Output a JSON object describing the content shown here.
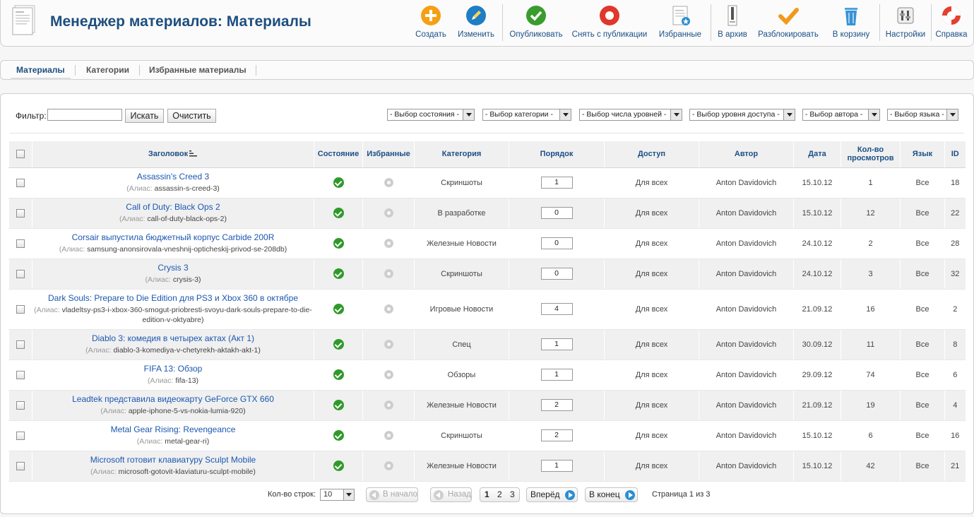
{
  "header": {
    "title": "Менеджер материалов: Материалы"
  },
  "toolbar": {
    "create": "Создать",
    "edit": "Изменить",
    "publish": "Опубликовать",
    "unpublish": "Снять с публикации",
    "featured": "Избранные",
    "archive": "В архив",
    "unlock": "Разблокировать",
    "trash": "В корзину",
    "settings": "Настройки",
    "help": "Справка"
  },
  "tabs": {
    "articles": "Материалы",
    "categories": "Категории",
    "featured": "Избранные материалы"
  },
  "filter": {
    "label": "Фильтр:",
    "value": "",
    "search_button": "Искать",
    "clear_button": "Очистить",
    "state_select": "- Выбор состояния -",
    "category_select": "- Выбор категории -",
    "levels_select": "- Выбор числа уровней -",
    "access_select": "- Выбор уровня доступа -",
    "author_select": "- Выбор автора -",
    "language_select": "- Выбор языка -"
  },
  "table": {
    "headers": {
      "title": "Заголовок",
      "state": "Состояние",
      "featured": "Избранные",
      "category": "Категория",
      "order": "Порядок",
      "access": "Доступ",
      "author": "Автор",
      "date": "Дата",
      "hits": "Кол-во просмотров",
      "language": "Язык",
      "id": "ID"
    },
    "alias_label": "(Алиас:",
    "rows": [
      {
        "title": "Assassin's Creed 3",
        "alias": "assassin-s-creed-3)",
        "category": "Скриншоты",
        "order": "1",
        "access": "Для всех",
        "author": "Anton Davidovich",
        "date": "15.10.12",
        "hits": "1",
        "language": "Все",
        "id": "18"
      },
      {
        "title": "Call of Duty: Black Ops 2",
        "alias": "call-of-duty-black-ops-2)",
        "category": "В разработке",
        "order": "0",
        "access": "Для всех",
        "author": "Anton Davidovich",
        "date": "15.10.12",
        "hits": "12",
        "language": "Все",
        "id": "22"
      },
      {
        "title": "Corsair выпустила бюджетный корпус Carbide 200R",
        "alias": "samsung-anonsirovala-vneshnij-opticheskij-privod-se-208db)",
        "category": "Железные Новости",
        "order": "0",
        "access": "Для всех",
        "author": "Anton Davidovich",
        "date": "24.10.12",
        "hits": "2",
        "language": "Все",
        "id": "28"
      },
      {
        "title": "Crysis 3",
        "alias": "crysis-3)",
        "category": "Скриншоты",
        "order": "0",
        "access": "Для всех",
        "author": "Anton Davidovich",
        "date": "24.10.12",
        "hits": "3",
        "language": "Все",
        "id": "32"
      },
      {
        "title": "Dark Souls: Prepare to Die Edition для PS3 и Xbox 360 в октябре",
        "alias": "vladeltsy-ps3-i-xbox-360-smogut-priobresti-svoyu-dark-souls-prepare-to-die-edition-v-oktyabre)",
        "category": "Игровые Новости",
        "order": "4",
        "access": "Для всех",
        "author": "Anton Davidovich",
        "date": "21.09.12",
        "hits": "16",
        "language": "Все",
        "id": "2"
      },
      {
        "title": "Diablo 3: комедия в четырех актах (Акт 1)",
        "alias": "diablo-3-komediya-v-chetyrekh-aktakh-akt-1)",
        "category": "Спец",
        "order": "1",
        "access": "Для всех",
        "author": "Anton Davidovich",
        "date": "30.09.12",
        "hits": "11",
        "language": "Все",
        "id": "8"
      },
      {
        "title": "FIFA 13: Обзор",
        "alias": "fifa-13)",
        "category": "Обзоры",
        "order": "1",
        "access": "Для всех",
        "author": "Anton Davidovich",
        "date": "29.09.12",
        "hits": "74",
        "language": "Все",
        "id": "6"
      },
      {
        "title": "Leadtek представила видеокарту GeForce GTX 660",
        "alias": "apple-iphone-5-vs-nokia-lumia-920)",
        "category": "Железные Новости",
        "order": "2",
        "access": "Для всех",
        "author": "Anton Davidovich",
        "date": "21.09.12",
        "hits": "19",
        "language": "Все",
        "id": "4"
      },
      {
        "title": "Metal Gear Rising: Revengeance",
        "alias": "metal-gear-ri)",
        "category": "Скриншоты",
        "order": "2",
        "access": "Для всех",
        "author": "Anton Davidovich",
        "date": "15.10.12",
        "hits": "6",
        "language": "Все",
        "id": "16"
      },
      {
        "title": "Microsoft готовит клавиатуру Sculpt Mobile",
        "alias": "microsoft-gotovit-klaviaturu-sculpt-mobile)",
        "category": "Железные Новости",
        "order": "1",
        "access": "Для всех",
        "author": "Anton Davidovich",
        "date": "15.10.12",
        "hits": "42",
        "language": "Все",
        "id": "21"
      }
    ]
  },
  "pagination": {
    "rows_label": "Кол-во строк:",
    "rows_value": "10",
    "first": "В начало",
    "prev": "Назад",
    "pages": [
      "1",
      "2",
      "3"
    ],
    "next": "Вперёд",
    "last": "В конец",
    "info": "Страница 1 из 3"
  }
}
